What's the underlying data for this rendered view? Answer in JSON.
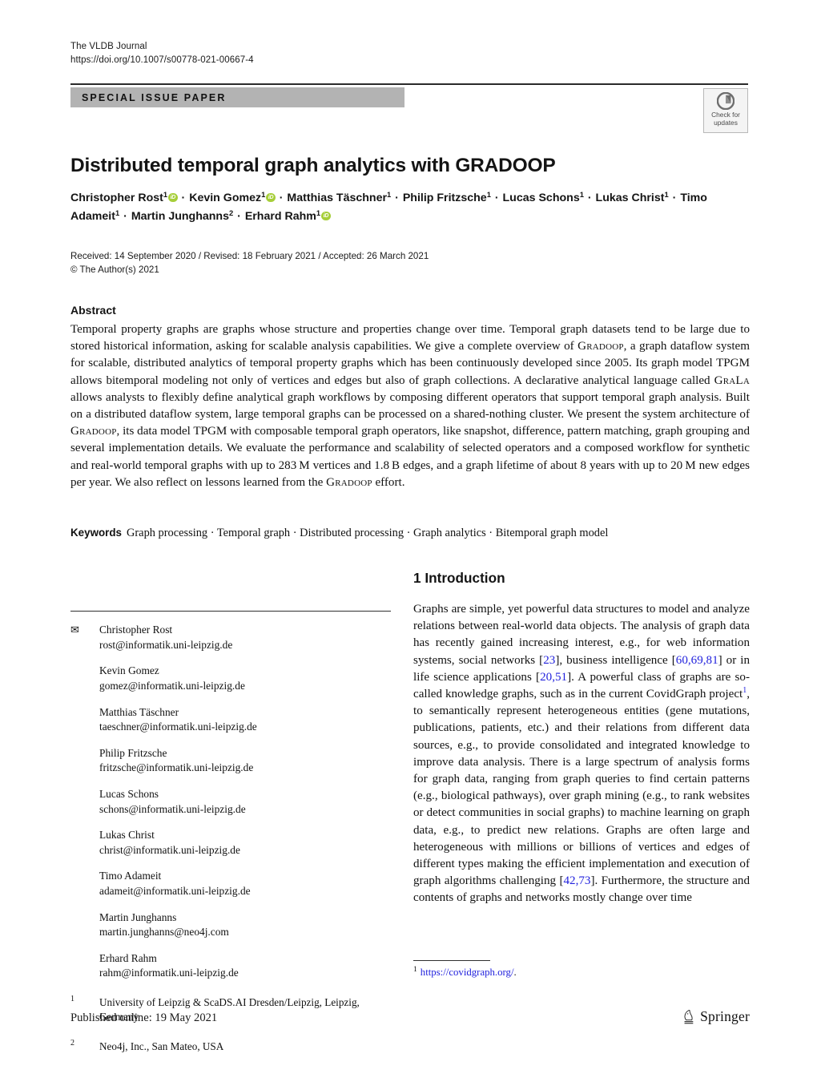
{
  "header": {
    "journal_name": "The VLDB Journal",
    "doi": "https://doi.org/10.1007/s00778-021-00667-4",
    "article_type": "SPECIAL ISSUE PAPER",
    "crossmark_line1": "Check for",
    "crossmark_line2": "updates"
  },
  "title": "Distributed temporal graph analytics with GRADOOP",
  "authors": [
    {
      "name": "Christopher Rost",
      "affiliation": "1",
      "orcid": true
    },
    {
      "name": "Kevin Gomez",
      "affiliation": "1",
      "orcid": true
    },
    {
      "name": "Matthias Täschner",
      "affiliation": "1",
      "orcid": false
    },
    {
      "name": "Philip Fritzsche",
      "affiliation": "1",
      "orcid": false
    },
    {
      "name": "Lucas Schons",
      "affiliation": "1",
      "orcid": false
    },
    {
      "name": "Lukas Christ",
      "affiliation": "1",
      "orcid": false
    },
    {
      "name": "Timo Adameit",
      "affiliation": "1",
      "orcid": false
    },
    {
      "name": "Martin Junghanns",
      "affiliation": "2",
      "orcid": false
    },
    {
      "name": "Erhard Rahm",
      "affiliation": "1",
      "orcid": true
    }
  ],
  "dates": {
    "received_line": "Received: 14 September 2020 / Revised: 18 February 2021 / Accepted: 26 March 2021",
    "copyright_line": "© The Author(s) 2021"
  },
  "abstract": {
    "heading": "Abstract",
    "part1": "Temporal property graphs are graphs whose structure and properties change over time. Temporal graph datasets tend to be large due to stored historical information, asking for scalable analysis capabilities. We give a complete overview of ",
    "sc1": "Gradoop",
    "part2": ", a graph dataflow system for scalable, distributed analytics of temporal property graphs which has been continuously developed since 2005. Its graph model TPGM allows bitemporal modeling not only of vertices and edges but also of graph collections. A declarative analytical language called ",
    "sc2": "GraLa",
    "part3": " allows analysts to flexibly define analytical graph workflows by composing different operators that support temporal graph analysis. Built on a distributed dataflow system, large temporal graphs can be processed on a shared-nothing cluster. We present the system architecture of ",
    "sc3": "Gradoop",
    "part4": ", its data model TPGM with composable temporal graph operators, like snapshot, difference, pattern matching, graph grouping and several implementation details. We evaluate the performance and scalability of selected operators and a composed workflow for synthetic and real-world temporal graphs with up to 283 M vertices and 1.8 B edges, and a graph lifetime of about 8 years with up to 20 M new edges per year. We also reflect on lessons learned from the ",
    "sc4": "Gradoop",
    "part5": " effort."
  },
  "keywords": {
    "label": "Keywords",
    "items": [
      "Graph processing",
      "Temporal graph",
      "Distributed processing",
      "Graph analytics",
      "Bitemporal graph model"
    ]
  },
  "correspondence": [
    {
      "name": "Christopher Rost",
      "email": "rost@informatik.uni-leipzig.de",
      "is_corresponding": true
    },
    {
      "name": "Kevin Gomez",
      "email": "gomez@informatik.uni-leipzig.de",
      "is_corresponding": false
    },
    {
      "name": "Matthias Täschner",
      "email": "taeschner@informatik.uni-leipzig.de",
      "is_corresponding": false
    },
    {
      "name": "Philip Fritzsche",
      "email": "fritzsche@informatik.uni-leipzig.de",
      "is_corresponding": false
    },
    {
      "name": "Lucas Schons",
      "email": "schons@informatik.uni-leipzig.de",
      "is_corresponding": false
    },
    {
      "name": "Lukas Christ",
      "email": "christ@informatik.uni-leipzig.de",
      "is_corresponding": false
    },
    {
      "name": "Timo Adameit",
      "email": "adameit@informatik.uni-leipzig.de",
      "is_corresponding": false
    },
    {
      "name": "Martin Junghanns",
      "email": "martin.junghanns@neo4j.com",
      "is_corresponding": false
    },
    {
      "name": "Erhard Rahm",
      "email": "rahm@informatik.uni-leipzig.de",
      "is_corresponding": false
    }
  ],
  "affiliations": [
    {
      "num": "1",
      "text": "University of Leipzig & ScaDS.AI Dresden/Leipzig, Leipzig, Germany"
    },
    {
      "num": "2",
      "text": "Neo4j, Inc., San Mateo, USA"
    }
  ],
  "introduction": {
    "heading": "1 Introduction",
    "p1_a": "Graphs are simple, yet powerful data structures to model and analyze relations between real-world data objects. The analysis of graph data has recently gained increasing interest, e.g., for web information systems, social networks [",
    "cite_23": "23",
    "p1_b": "], business intelligence [",
    "cite_606981": "60,69,81",
    "p1_c": "] or in life science applications [",
    "cite_2051": "20,51",
    "p1_d": "]. A powerful class of graphs are so-called knowledge graphs, such as in the current CovidGraph project",
    "fn_marker": "1",
    "p1_e": ", to semantically represent heterogeneous entities (gene mutations, publications, patients, etc.) and their relations from different data sources, e.g., to provide consolidated and integrated knowledge to improve data analysis. There is a large spectrum of analysis forms for graph data, ranging from graph queries to find certain patterns (e.g., biological pathways), over graph mining (e.g., to rank websites or detect communities in social graphs) to machine learning on graph data, e.g., to predict new relations. Graphs are often large and heterogeneous with millions or billions of vertices and edges of different types making the efficient implementation and execution of graph algorithms challenging [",
    "cite_4273": "42,73",
    "p1_f": "]. Furthermore, the structure and contents of graphs and networks mostly change over time"
  },
  "footnote": {
    "num": "1",
    "url": "https://covidgraph.org/",
    "trailing": "."
  },
  "footer": {
    "published_online": "Published online: 19 May 2021",
    "publisher": "Springer"
  },
  "colors": {
    "banner_bg": "#b3b3b3",
    "citation_blue": "#2222dd",
    "orcid_green": "#a6ce39"
  }
}
